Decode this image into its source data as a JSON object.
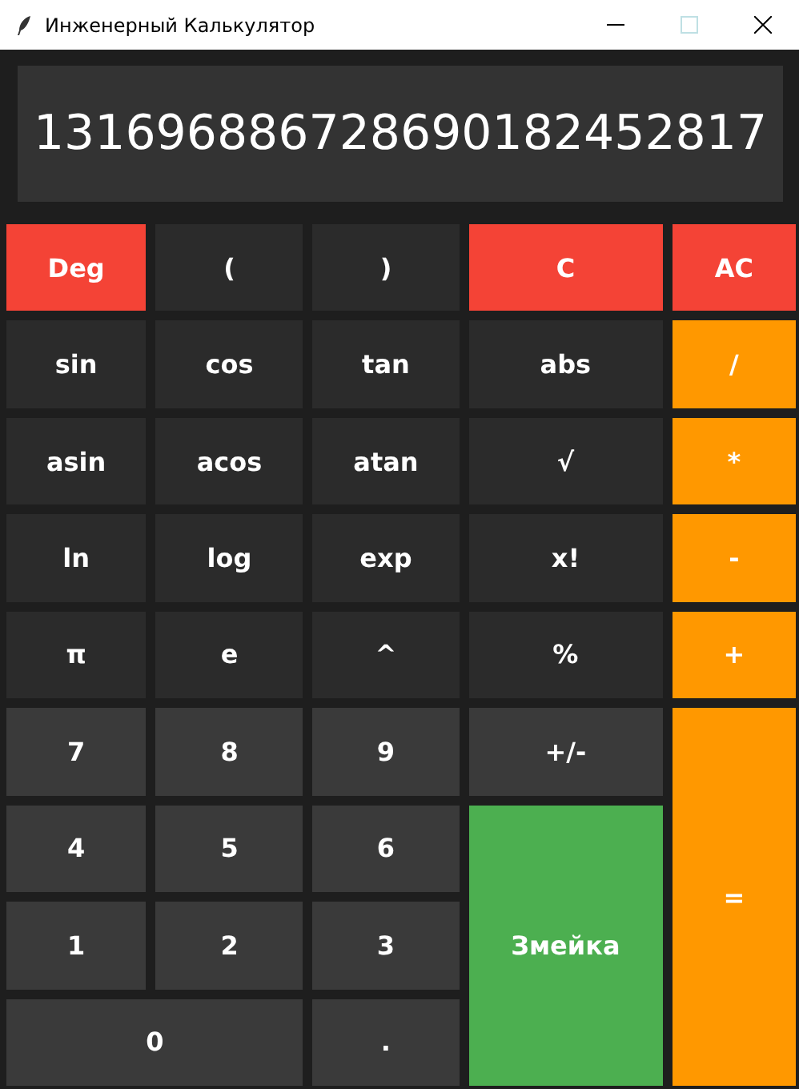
{
  "window": {
    "title": "Инженерный Калькулятор"
  },
  "display": {
    "value": "131696886728690182452817"
  },
  "buttons": [
    {
      "label": "Deg",
      "kind": "mode"
    },
    {
      "label": "(",
      "kind": "function"
    },
    {
      "label": ")",
      "kind": "function"
    },
    {
      "label": "C",
      "kind": "clear"
    },
    {
      "label": "AC",
      "kind": "clear"
    },
    {
      "label": "sin",
      "kind": "function"
    },
    {
      "label": "cos",
      "kind": "function"
    },
    {
      "label": "tan",
      "kind": "function"
    },
    {
      "label": "abs",
      "kind": "function"
    },
    {
      "label": "/",
      "kind": "operator"
    },
    {
      "label": "asin",
      "kind": "function"
    },
    {
      "label": "acos",
      "kind": "function"
    },
    {
      "label": "atan",
      "kind": "function"
    },
    {
      "label": "√",
      "kind": "function"
    },
    {
      "label": "*",
      "kind": "operator"
    },
    {
      "label": "ln",
      "kind": "function"
    },
    {
      "label": "log",
      "kind": "function"
    },
    {
      "label": "exp",
      "kind": "function"
    },
    {
      "label": "x!",
      "kind": "function"
    },
    {
      "label": "-",
      "kind": "operator"
    },
    {
      "label": "π",
      "kind": "function"
    },
    {
      "label": "e",
      "kind": "function"
    },
    {
      "label": "^",
      "kind": "function"
    },
    {
      "label": "%",
      "kind": "function"
    },
    {
      "label": "+",
      "kind": "operator"
    },
    {
      "label": "7",
      "kind": "digit"
    },
    {
      "label": "8",
      "kind": "digit"
    },
    {
      "label": "9",
      "kind": "digit"
    },
    {
      "label": "+/-",
      "kind": "digit"
    },
    {
      "label": "=",
      "kind": "operator"
    },
    {
      "label": "4",
      "kind": "digit"
    },
    {
      "label": "5",
      "kind": "digit"
    },
    {
      "label": "6",
      "kind": "digit"
    },
    {
      "label": "1",
      "kind": "digit"
    },
    {
      "label": "2",
      "kind": "digit"
    },
    {
      "label": "3",
      "kind": "digit"
    },
    {
      "label": "Змейка",
      "kind": "action"
    },
    {
      "label": "0",
      "kind": "digit"
    },
    {
      "label": ".",
      "kind": "digit"
    }
  ]
}
